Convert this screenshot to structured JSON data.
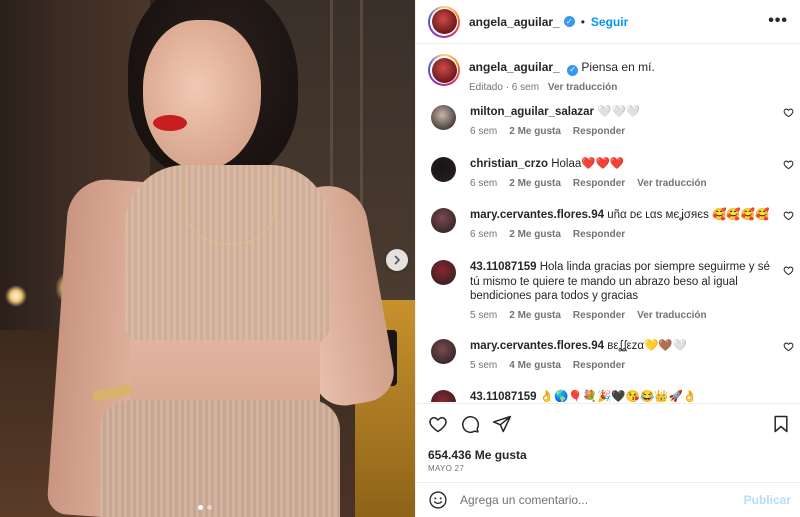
{
  "post": {
    "username": "angela_aguilar_",
    "separator": "•",
    "follow_label": "Seguir",
    "more_label": "•••",
    "verified_glyph": "✓"
  },
  "caption": {
    "username": "angela_aguilar_",
    "text": "Piensa en mí.",
    "edited": "Editado · 6 sem",
    "translate": "Ver traducción"
  },
  "comments": [
    {
      "user": "milton_aguilar_salazar",
      "text": "🤍🤍🤍",
      "time": "6 sem",
      "likes": "2 Me gusta",
      "reply": "Responder",
      "translate": "",
      "avatar": "#c9b7a8"
    },
    {
      "user": "christian_crzo",
      "text": "Holaa❤️❤️❤️",
      "time": "6 sem",
      "likes": "2 Me gusta",
      "reply": "Responder",
      "translate": "Ver traducción",
      "avatar": "#141414"
    },
    {
      "user": "mary.cervantes.flores.94",
      "text": "uñα ᴅє ʟαѕ мєʝσяєѕ 🥰🥰🥰🥰",
      "time": "6 sem",
      "likes": "2 Me gusta",
      "reply": "Responder",
      "translate": "",
      "avatar": "#7a4a4e"
    },
    {
      "user": "43.11087159",
      "text": "Hola linda gracias por siempre seguirme y sé tú mismo te quiere te mando un abrazo beso al igual bendiciones para todos y gracias",
      "time": "5 sem",
      "likes": "2 Me gusta",
      "reply": "Responder",
      "translate": "Ver traducción",
      "avatar": "#8c2530"
    },
    {
      "user": "mary.cervantes.flores.94",
      "text": "вεʆʆεzα💛🤎🤍",
      "time": "5 sem",
      "likes": "4 Me gusta",
      "reply": "Responder",
      "translate": "",
      "avatar": "#7a4a4e"
    },
    {
      "user": "43.11087159",
      "text": "👌🌎🎈💐🎉🖤😘😂👑🚀👌",
      "time": "",
      "likes": "",
      "reply": "",
      "translate": "",
      "avatar": "#8c2530"
    }
  ],
  "footer": {
    "likes": "654.436 Me gusta",
    "date": "MAYO 27",
    "comment_placeholder": "Agrega un comentario...",
    "post_label": "Publicar"
  },
  "colors": {
    "accent": "#0095f6",
    "verified": "#3897f0",
    "muted": "#737373",
    "post_disabled": "#b2dffc"
  },
  "icons": [
    "verified-icon",
    "more-options-icon",
    "next-arrow-icon",
    "heart-icon",
    "comment-icon",
    "share-icon",
    "bookmark-icon",
    "emoji-icon"
  ],
  "carousel": {
    "count": 2,
    "active": 0
  }
}
